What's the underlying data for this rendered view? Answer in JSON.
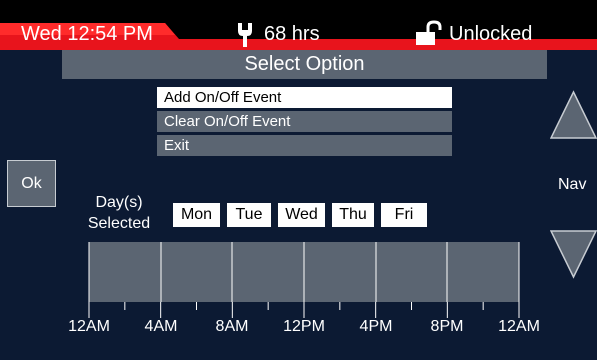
{
  "status_bar": {
    "datetime": "Wed 12:54 PM",
    "hours": "68 hrs",
    "lock_status": "Unlocked",
    "accent_color": "#e8141c"
  },
  "dialog": {
    "title": "Select Option",
    "options": [
      "Add On/Off Event",
      "Clear On/Off Event",
      "Exit"
    ],
    "selected_option": "Add On/Off Event"
  },
  "ok_button": {
    "label": "Ok"
  },
  "nav": {
    "label": "Nav"
  },
  "days": {
    "label_line1": "Day(s)",
    "label_line2": "Selected",
    "items": [
      "Mon",
      "Tue",
      "Wed",
      "Thu",
      "Fri"
    ]
  },
  "timeline": {
    "labels": [
      "12AM",
      "4AM",
      "8AM",
      "12PM",
      "4PM",
      "8PM",
      "12AM"
    ]
  }
}
